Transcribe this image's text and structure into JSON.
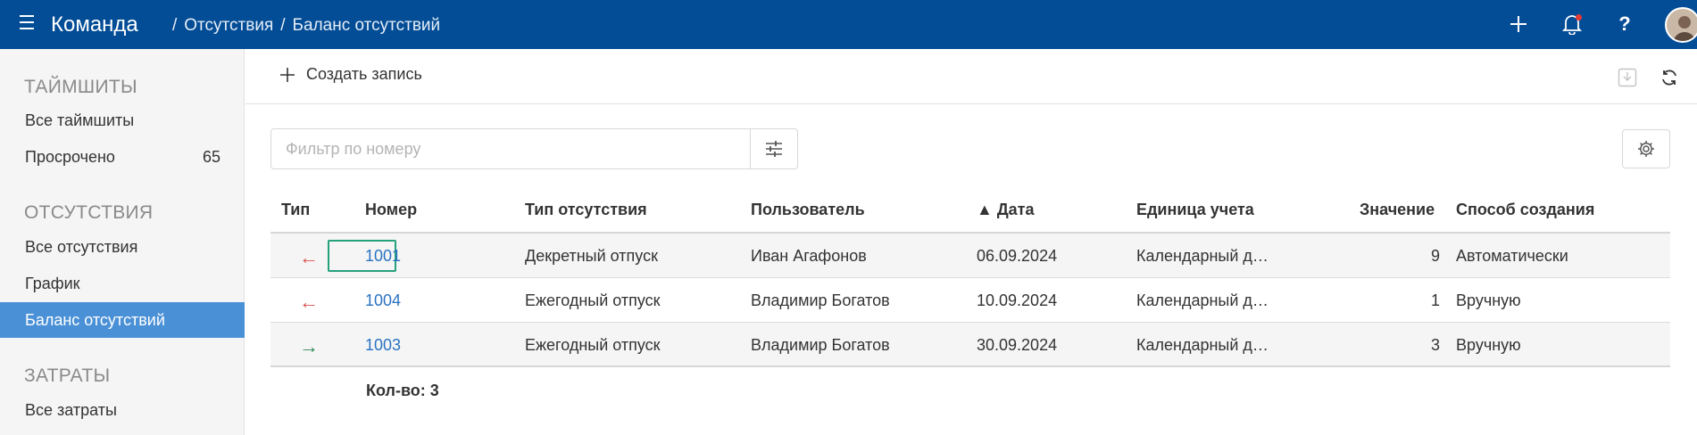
{
  "header": {
    "app_title": "Команда",
    "breadcrumb": [
      "Отсутствия",
      "Баланс отсутствий"
    ],
    "icons": [
      "menu-icon",
      "plus-icon",
      "bell-icon",
      "help-icon",
      "avatar"
    ],
    "colors": {
      "topbar": "#034d96",
      "notification": "#e53935"
    }
  },
  "sidebar": {
    "sections": [
      {
        "title": "ТАЙМШИТЫ",
        "items": [
          {
            "label": "Все таймшиты"
          },
          {
            "label": "Просрочено",
            "count": "65"
          }
        ]
      },
      {
        "title": "ОТСУТСТВИЯ",
        "items": [
          {
            "label": "Все отсутствия"
          },
          {
            "label": "График"
          },
          {
            "label": "Баланс отсутствий",
            "active": true
          }
        ]
      },
      {
        "title": "ЗАТРАТЫ",
        "items": [
          {
            "label": "Все затраты"
          }
        ]
      }
    ],
    "active_color": "#4a90d6"
  },
  "toolbar": {
    "create_label": "Создать запись"
  },
  "filter": {
    "placeholder": "Фильтр по номеру",
    "value": ""
  },
  "table": {
    "columns": [
      "Тип",
      "Номер",
      "Тип отсутствия",
      "Пользователь",
      "▲ Дата",
      "Единица учета",
      "Значение",
      "Способ создания"
    ],
    "rows": [
      {
        "direction": "out",
        "arrow": "←",
        "number": "1001",
        "absence_type": "Декретный отпуск",
        "user": "Иван Агафонов",
        "date": "06.09.2024",
        "unit": "Календарный д…",
        "value": "9",
        "method": "Автоматически"
      },
      {
        "direction": "out",
        "arrow": "←",
        "number": "1004",
        "absence_type": "Ежегодный отпуск",
        "user": "Владимир Богатов",
        "date": "10.09.2024",
        "unit": "Календарный д…",
        "value": "1",
        "method": "Вручную"
      },
      {
        "direction": "in",
        "arrow": "→",
        "number": "1003",
        "absence_type": "Ежегодный отпуск",
        "user": "Владимир Богатов",
        "date": "30.09.2024",
        "unit": "Календарный д…",
        "value": "3",
        "method": "Вручную"
      }
    ],
    "count_label": "Кол-во: 3"
  }
}
